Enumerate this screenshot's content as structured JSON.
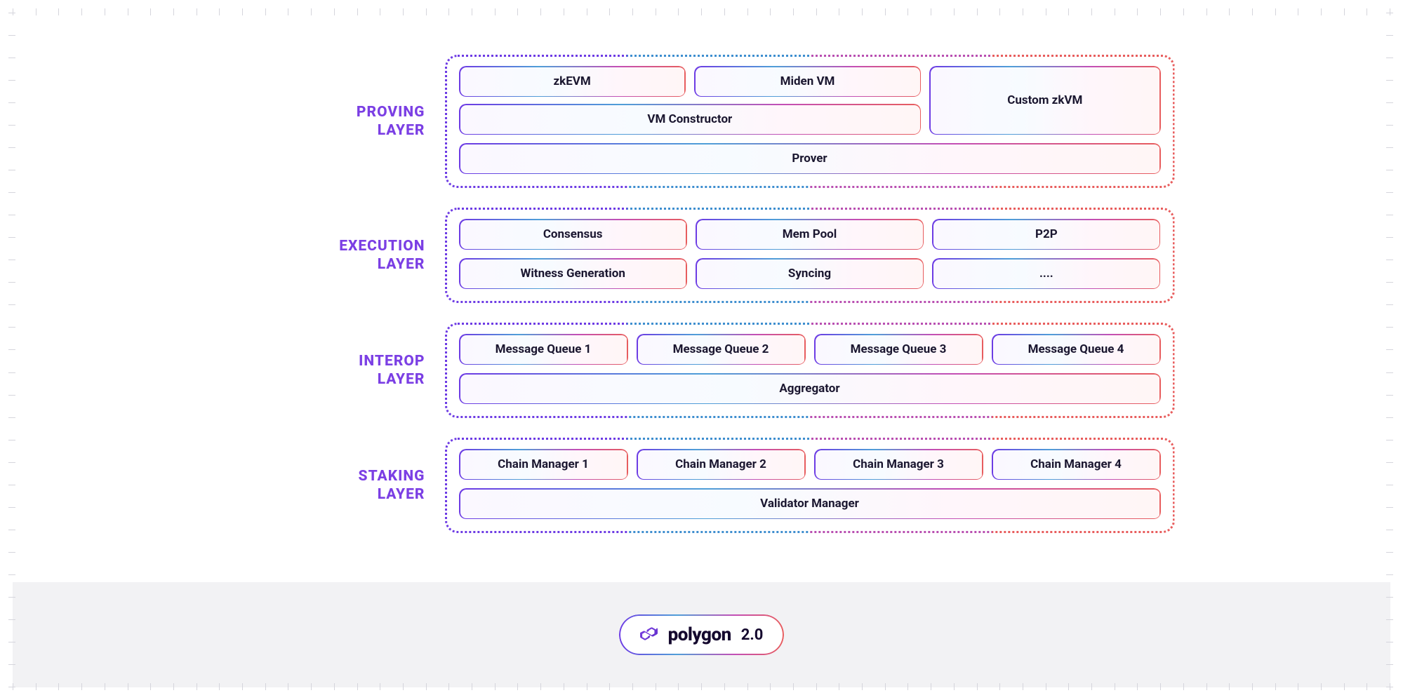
{
  "layers": {
    "proving": {
      "title_line1": "PROVING",
      "title_line2": "LAYER",
      "zkevm": "zkEVM",
      "miden": "Miden VM",
      "custom": "Custom zkVM",
      "constructor": "VM Constructor",
      "prover": "Prover"
    },
    "execution": {
      "title_line1": "EXECUTION",
      "title_line2": "LAYER",
      "consensus": "Consensus",
      "mempool": "Mem Pool",
      "p2p": "P2P",
      "witness": "Witness Generation",
      "syncing": "Syncing",
      "etc": "...."
    },
    "interop": {
      "title_line1": "INTEROP",
      "title_line2": "LAYER",
      "mq1": "Message Queue 1",
      "mq2": "Message Queue 2",
      "mq3": "Message Queue 3",
      "mq4": "Message Queue 4",
      "aggregator": "Aggregator"
    },
    "staking": {
      "title_line1": "STAKING",
      "title_line2": "LAYER",
      "cm1": "Chain Manager 1",
      "cm2": "Chain Manager 2",
      "cm3": "Chain Manager 3",
      "cm4": "Chain Manager 4",
      "validator": "Validator Manager"
    }
  },
  "footer": {
    "brand": "polygon",
    "version": "2.0"
  }
}
